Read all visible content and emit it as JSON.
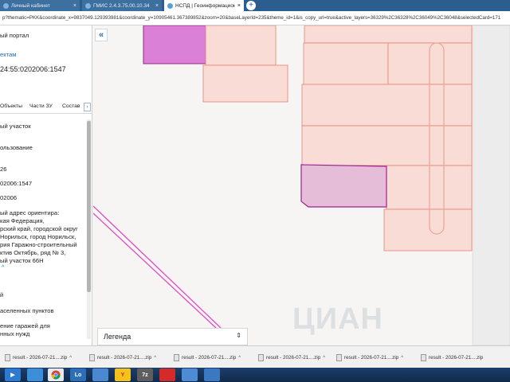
{
  "browser": {
    "tabs": [
      {
        "label": "Личный кабинет"
      },
      {
        "label": "ГМИС 2.4.3.75.00.10.34"
      },
      {
        "label": "НСПД | Геоинформационный"
      }
    ],
    "tab_close": "×",
    "new_tab": "+",
    "address": "p?thematic=PKK&coordinate_x=9837049.129393981&coordinate_y=10905461.367389852&zoom=20&baseLayerId=235&theme_id=1&is_copy_url=true&active_layers=36329%2C36328%2C36049%2C36048&selectedCard=171"
  },
  "sidebar": {
    "portal": "ый портал",
    "objects_link": "ектам",
    "cadastral_number": "24:55:0202006:1547",
    "tabs": [
      "Объекты",
      "Части ЗУ",
      "Состав"
    ],
    "tab_arrow": "›",
    "lines": [
      "ый участок",
      "ользование",
      "26",
      "02006:1547",
      "02006",
      "ый адрес ориентира:",
      "кая Федерация,",
      "рский край, городской округ",
      "Норильск, город Норильск,",
      "рия Гаражно-строительный",
      "ктив Октябрь, ряд № 3,",
      "ый участок 66Н",
      "й",
      "аселенных пунктов",
      "ение гаражей для",
      "нных нужд"
    ],
    "collapse_chevron": "^"
  },
  "map": {
    "collapse_button": "«",
    "legend_label": "Легенда",
    "legend_arrow": "⇕",
    "watermark": "ЦИАН"
  },
  "downloads": {
    "items": [
      "result - 2026-07-21....zip",
      "result - 2026-07-21....zip",
      "result - 2026-07-21....zip",
      "result - 2026-07-21....zip",
      "result - 2026-07-21....zip",
      "result - 2026-07-21....zip"
    ],
    "chevron": "^"
  },
  "taskbar": {
    "start_icon": "▶",
    "yandex_label": "Y",
    "office_label": "Lo",
    "archive_label": "7z"
  },
  "colors": {
    "parcel_fill": "#f9dcd6",
    "parcel_stroke": "#e8826f",
    "selected_fill": "#e6bdd9",
    "selected_stroke": "#a0208e",
    "magenta_fill": "#da80d6"
  }
}
